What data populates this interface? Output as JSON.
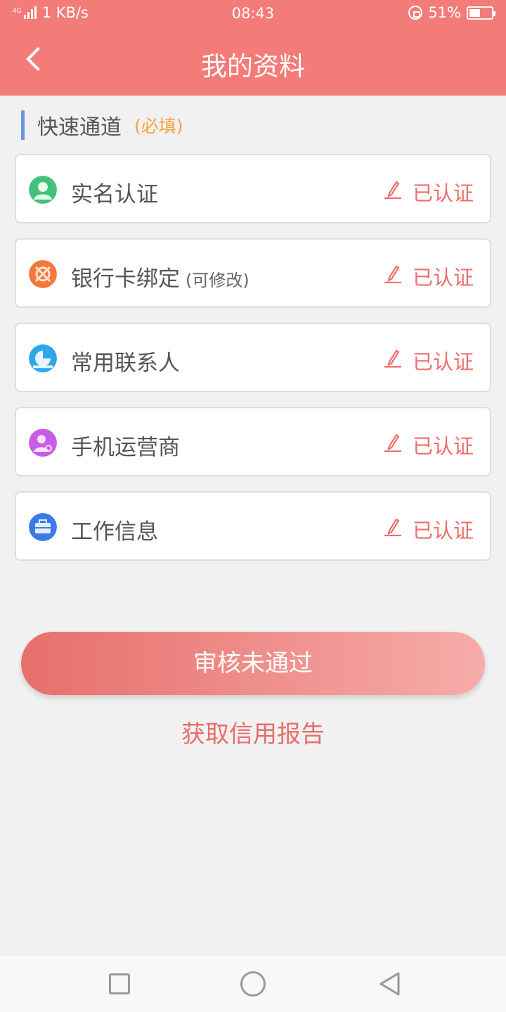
{
  "status_bar": {
    "network_tag": "4G",
    "net_speed": "1 KB/s",
    "time": "08:43",
    "battery_percent": "51%",
    "battery_level": 0.51
  },
  "header": {
    "title": "我的资料",
    "back_icon": "chevron-left-icon"
  },
  "section": {
    "title": "快速通道",
    "required_note": "(必填)"
  },
  "items": [
    {
      "label": "实名认证",
      "sub_label": "",
      "status": "已认证",
      "icon": "user-id-icon",
      "icon_color": "#45c07a"
    },
    {
      "label": "银行卡绑定",
      "sub_label": "(可修改)",
      "status": "已认证",
      "icon": "bank-card-icon",
      "icon_color": "#f5783c"
    },
    {
      "label": "常用联系人",
      "sub_label": "",
      "status": "已认证",
      "icon": "contacts-icon",
      "icon_color": "#2fa6ec"
    },
    {
      "label": "手机运营商",
      "sub_label": "",
      "status": "已认证",
      "icon": "mobile-operator-icon",
      "icon_color": "#c95de6"
    },
    {
      "label": "工作信息",
      "sub_label": "",
      "status": "已认证",
      "icon": "briefcase-icon",
      "icon_color": "#3b7ae6"
    }
  ],
  "actions": {
    "submit_label": "审核未通过",
    "report_link": "获取信用报告"
  },
  "colors": {
    "header_bg": "#f37b78",
    "accent": "#ef6e6b",
    "section_bar": "#6a97e0",
    "required_text": "#f5a340"
  },
  "nav_bar": {
    "icons": [
      "recent-apps-icon",
      "home-icon",
      "back-triangle-icon"
    ]
  }
}
